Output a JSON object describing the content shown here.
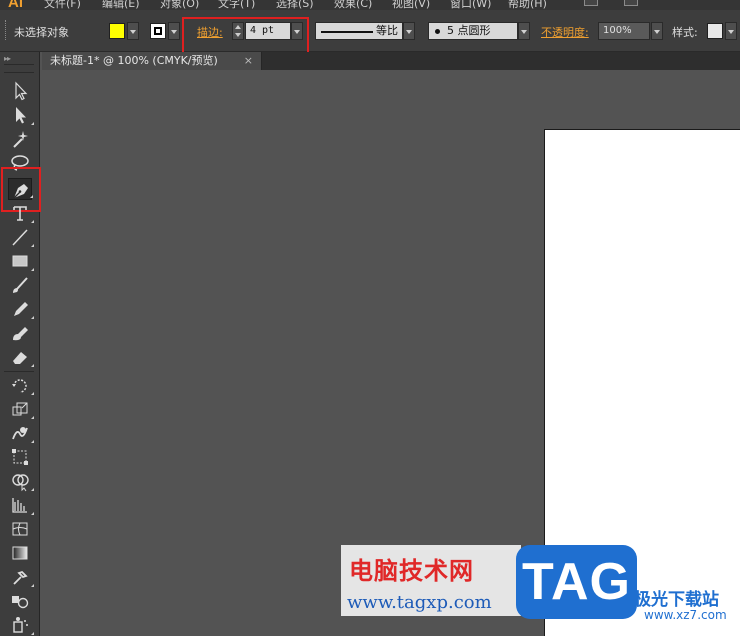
{
  "app": {
    "logo": "Ai"
  },
  "menu": {
    "items": [
      "文件(F)",
      "编辑(E)",
      "对象(O)",
      "文字(T)",
      "选择(S)",
      "效果(C)",
      "视图(V)",
      "窗口(W)",
      "帮助(H)"
    ]
  },
  "controlbar": {
    "selection_status": "未选择对象",
    "fill_color": "#ffff00",
    "stroke_label": "描边:",
    "stroke_weight": "4 pt",
    "stroke_profile": "等比",
    "brush": "5 点圆形",
    "opacity_label": "不透明度:",
    "opacity_value": "100%",
    "style_label": "样式:"
  },
  "document": {
    "tab_title": "未标题-1* @ 100% (CMYK/预览)",
    "close_glyph": "×"
  },
  "toolbox": {
    "tools": [
      "selection-tool",
      "direct-selection-tool",
      "magic-wand-tool",
      "lasso-tool",
      "pen-tool",
      "type-tool",
      "line-segment-tool",
      "rectangle-tool",
      "paintbrush-tool",
      "pencil-tool",
      "blob-brush-tool",
      "eraser-tool",
      "rotate-tool",
      "scale-tool",
      "warp-tool",
      "free-transform-tool",
      "shape-builder-tool",
      "perspective-grid-tool",
      "mesh-tool",
      "gradient-tool",
      "eyedropper-tool",
      "blend-tool",
      "symbol-sprayer-tool"
    ],
    "active_tool": "pen-tool"
  },
  "watermark": {
    "title": "电脑技术网",
    "url": "www.tagxp.com",
    "tag": "TAG",
    "site": "极光下载站",
    "domain": "www.xz7.com"
  },
  "colors": {
    "highlight_border": "#e02020",
    "accent_orange": "#f0a030",
    "canvas_bg": "#535353",
    "artboard": "#ffffff"
  }
}
